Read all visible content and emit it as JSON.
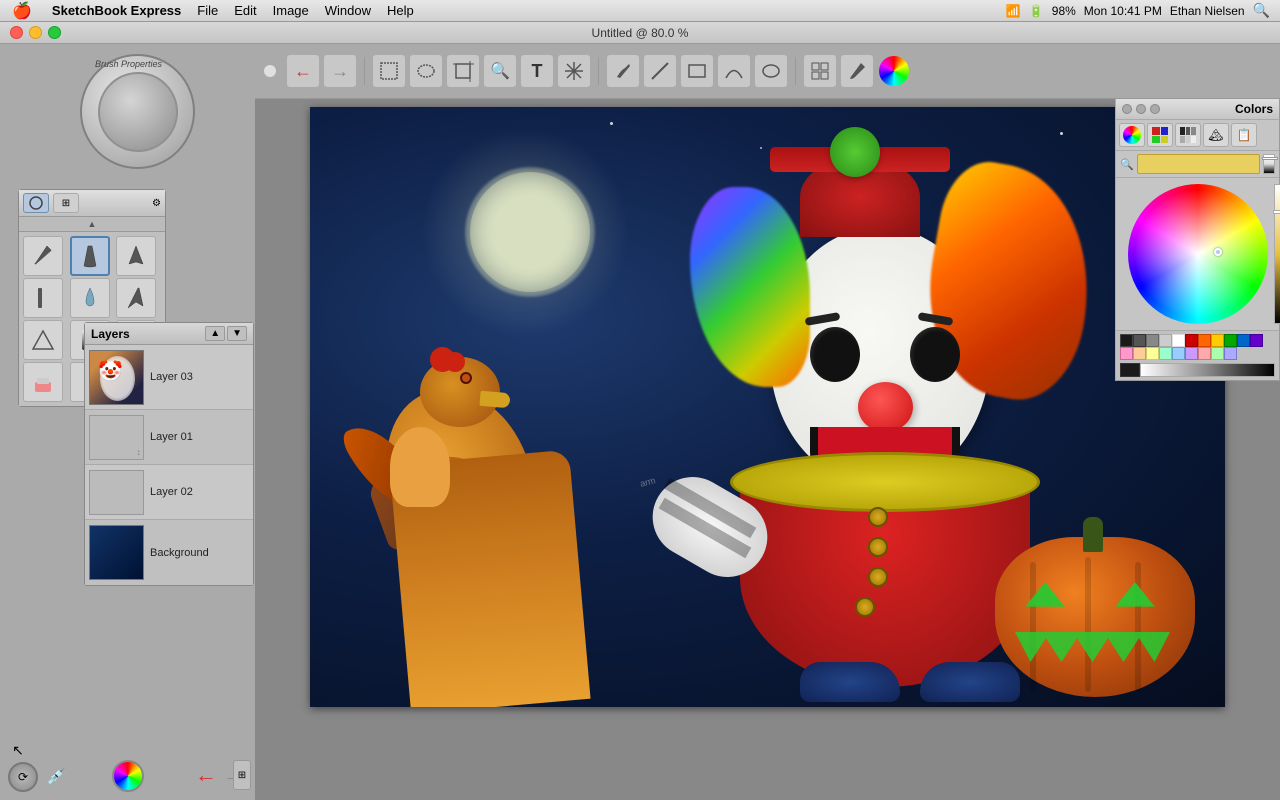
{
  "menubar": {
    "apple": "🍎",
    "app_name": "SketchBook Express",
    "items": [
      "File",
      "Edit",
      "Image",
      "Window",
      "Help"
    ],
    "time": "Mon 10:41 PM",
    "user": "Ethan Nielsen",
    "battery": "98%"
  },
  "titlebar": {
    "title": "Untitled @ 80.0 %"
  },
  "toolbar": {
    "tools": [
      {
        "name": "undo",
        "icon": "←",
        "label": "Undo"
      },
      {
        "name": "redo",
        "icon": "→",
        "label": "Redo"
      },
      {
        "name": "select-rect",
        "icon": "▭",
        "label": "Rectangle Select"
      },
      {
        "name": "select-lasso",
        "icon": "⬭",
        "label": "Lasso Select"
      },
      {
        "name": "crop",
        "icon": "⊠",
        "label": "Crop"
      },
      {
        "name": "zoom",
        "icon": "🔍",
        "label": "Zoom"
      },
      {
        "name": "text",
        "icon": "T",
        "label": "Text"
      },
      {
        "name": "transform",
        "icon": "⊕",
        "label": "Transform"
      },
      {
        "name": "pen",
        "icon": "✒",
        "label": "Pen"
      },
      {
        "name": "line",
        "icon": "/",
        "label": "Line"
      },
      {
        "name": "rect-shape",
        "icon": "□",
        "label": "Rectangle Shape"
      },
      {
        "name": "arc",
        "icon": "∧",
        "label": "Arc"
      },
      {
        "name": "ellipse",
        "icon": "○",
        "label": "Ellipse"
      },
      {
        "name": "stamp",
        "icon": "⧉",
        "label": "Stamp"
      },
      {
        "name": "brush2",
        "icon": "🖌",
        "label": "Brush"
      },
      {
        "name": "color-wheel-tool",
        "icon": "🎨",
        "label": "Color Wheel"
      }
    ]
  },
  "layers": {
    "title": "Layers",
    "items": [
      {
        "name": "Layer 03",
        "type": "clown",
        "visible": true
      },
      {
        "name": "Layer 01",
        "type": "empty",
        "visible": true
      },
      {
        "name": "Layer 02",
        "type": "empty",
        "visible": true
      },
      {
        "name": "Background",
        "type": "background",
        "visible": true
      }
    ]
  },
  "colors": {
    "title": "Colors",
    "tabs": [
      "wheel",
      "swatches",
      "grid",
      "image",
      "palette"
    ],
    "search_placeholder": "",
    "current_color": "#e8d060",
    "swatches": [
      "#000000",
      "#333333",
      "#666666",
      "#999999",
      "#cccccc",
      "#ffffff",
      "#cc0000",
      "#ff6600",
      "#ffcc00",
      "#00aa00",
      "#0066cc",
      "#6600cc",
      "#ff99cc",
      "#ffcc99",
      "#ffff99",
      "#99ffcc",
      "#99ccff",
      "#cc99ff"
    ]
  },
  "brush_panel": {
    "selected": 1,
    "brushes": [
      "pencil",
      "marker",
      "ink",
      "flat",
      "wide",
      "thin",
      "spray",
      "drop",
      "blob",
      "triangle",
      "gradient",
      "bucket",
      "eraser",
      "bucket2",
      "stamp"
    ]
  },
  "bottom_tools": {
    "prev": "←",
    "next": "→"
  },
  "status": {
    "zoom": "80.0 %"
  }
}
